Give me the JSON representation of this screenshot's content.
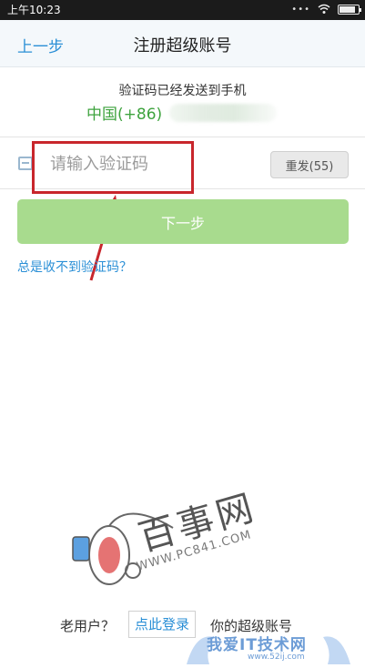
{
  "status_bar": {
    "time": "上午10:23"
  },
  "header": {
    "back_label": "上一步",
    "title": "注册超级账号"
  },
  "info": {
    "sent_message": "验证码已经发送到手机",
    "country_code": "中国(+86)"
  },
  "code_input": {
    "placeholder": "请输入验证码",
    "value": ""
  },
  "resend_label": "重发(55)",
  "next_label": "下一步",
  "help_link": "总是收不到验证码？",
  "footer": {
    "prefix": "老用户？",
    "login_link": "点此登录",
    "suffix": "你的超级账号"
  },
  "watermark": {
    "main": "百事网",
    "url": "WWW.PC841.COM"
  },
  "watermark2": {
    "main": "我爱IT技术网",
    "url": "www.52ij.com"
  },
  "colors": {
    "accent_blue": "#2a8fd6",
    "green_text": "#3ea33e",
    "next_button": "#a8db8e",
    "highlight_red": "#c8262c"
  }
}
